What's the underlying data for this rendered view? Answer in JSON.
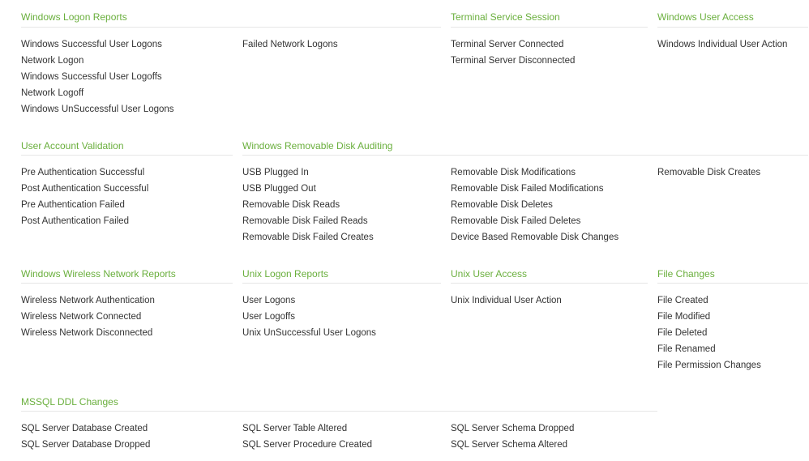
{
  "sections": {
    "windows_logon_reports": {
      "title": "Windows Logon Reports",
      "col1": [
        "Windows Successful User Logons",
        "Network Logon",
        "Windows Successful User Logoffs",
        "Network Logoff",
        "Windows UnSuccessful User Logons"
      ],
      "col2": [
        "Failed Network Logons"
      ]
    },
    "terminal_service_session": {
      "title": "Terminal Service Session",
      "items": [
        "Terminal Server Connected",
        "Terminal Server Disconnected"
      ]
    },
    "windows_user_access": {
      "title": "Windows User Access",
      "items": [
        "Windows Individual User Action"
      ]
    },
    "user_account_validation": {
      "title": "User Account Validation",
      "items": [
        "Pre Authentication Successful",
        "Post Authentication Successful",
        "Pre Authentication Failed",
        "Post Authentication Failed"
      ]
    },
    "windows_removable_disk_auditing": {
      "title": "Windows Removable Disk Auditing",
      "col1": [
        "USB Plugged In",
        "USB Plugged Out",
        "Removable Disk Reads",
        "Removable Disk Failed Reads",
        "Removable Disk Failed Creates"
      ],
      "col2": [
        "Removable Disk Modifications",
        "Removable Disk Failed Modifications",
        "Removable Disk Deletes",
        "Removable Disk Failed Deletes",
        "Device Based Removable Disk Changes"
      ],
      "col3": [
        "Removable Disk Creates"
      ]
    },
    "windows_wireless_network_reports": {
      "title": "Windows Wireless Network Reports",
      "items": [
        "Wireless Network Authentication",
        "Wireless Network Connected",
        "Wireless Network Disconnected"
      ]
    },
    "unix_logon_reports": {
      "title": "Unix Logon Reports",
      "items": [
        "User Logons",
        "User Logoffs",
        "Unix UnSuccessful User Logons"
      ]
    },
    "unix_user_access": {
      "title": "Unix User Access",
      "items": [
        "Unix Individual User Action"
      ]
    },
    "file_changes": {
      "title": "File Changes",
      "items": [
        "File Created",
        "File Modified",
        "File Deleted",
        "File Renamed",
        "File Permission Changes"
      ]
    },
    "mssql_ddl_changes": {
      "title": "MSSQL DDL Changes",
      "col1": [
        "SQL Server Database Created",
        "SQL Server Database Dropped"
      ],
      "col2": [
        "SQL Server Table Altered",
        "SQL Server Procedure Created"
      ],
      "col3": [
        "SQL Server Schema Dropped",
        "SQL Server Schema Altered"
      ]
    }
  }
}
